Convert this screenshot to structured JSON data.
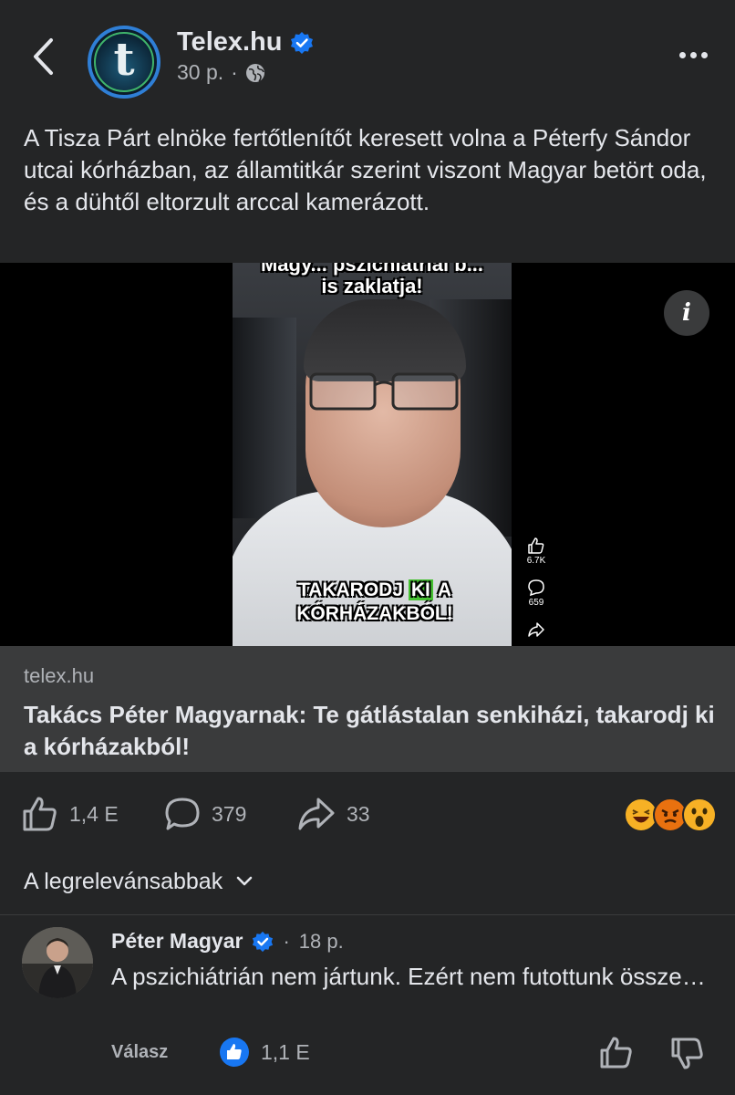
{
  "header": {
    "page_name": "Telex.hu",
    "time": "30 p.",
    "separator": "·",
    "avatar_letter": "t"
  },
  "post": {
    "text": "A Tisza Párt elnöke fertőtlenítőt keresett volna a Péterfy Sándor utcai kórházban, az államtitkár szerint viszont Magyar betört oda, és a dühtől eltorzult arccal kamerázott."
  },
  "video": {
    "overlay_top_line1": "Magy... pszichiátriai b...",
    "overlay_top_line2": "is zaklatja!",
    "overlay_bottom_1": "TAKARODJ",
    "overlay_bottom_ki": "KI",
    "overlay_bottom_2": "A",
    "overlay_bottom_3": "KÓRHÁZAKBÓL!",
    "likes": "6.7K",
    "comments": "659",
    "info_icon": "i"
  },
  "link": {
    "domain": "telex.hu",
    "title": "Takács Péter Magyarnak: Te gátlástalan senkiházi, takarodj ki a kórházakból!"
  },
  "actions": {
    "likes": "1,4 E",
    "comments": "379",
    "shares": "33"
  },
  "sort": {
    "label": "A legrelevánsabbak"
  },
  "comment": {
    "author": "Péter Magyar",
    "separator": "·",
    "time": "18 p.",
    "text": "A pszichiátrián nem jártunk. Ezért nem futottunk össze…",
    "reply_label": "Válasz",
    "like_count": "1,1 E"
  },
  "colors": {
    "background": "#242526",
    "verified": "#1877f2",
    "text_primary": "#e4e6eb",
    "text_secondary": "#b0b3b8"
  }
}
